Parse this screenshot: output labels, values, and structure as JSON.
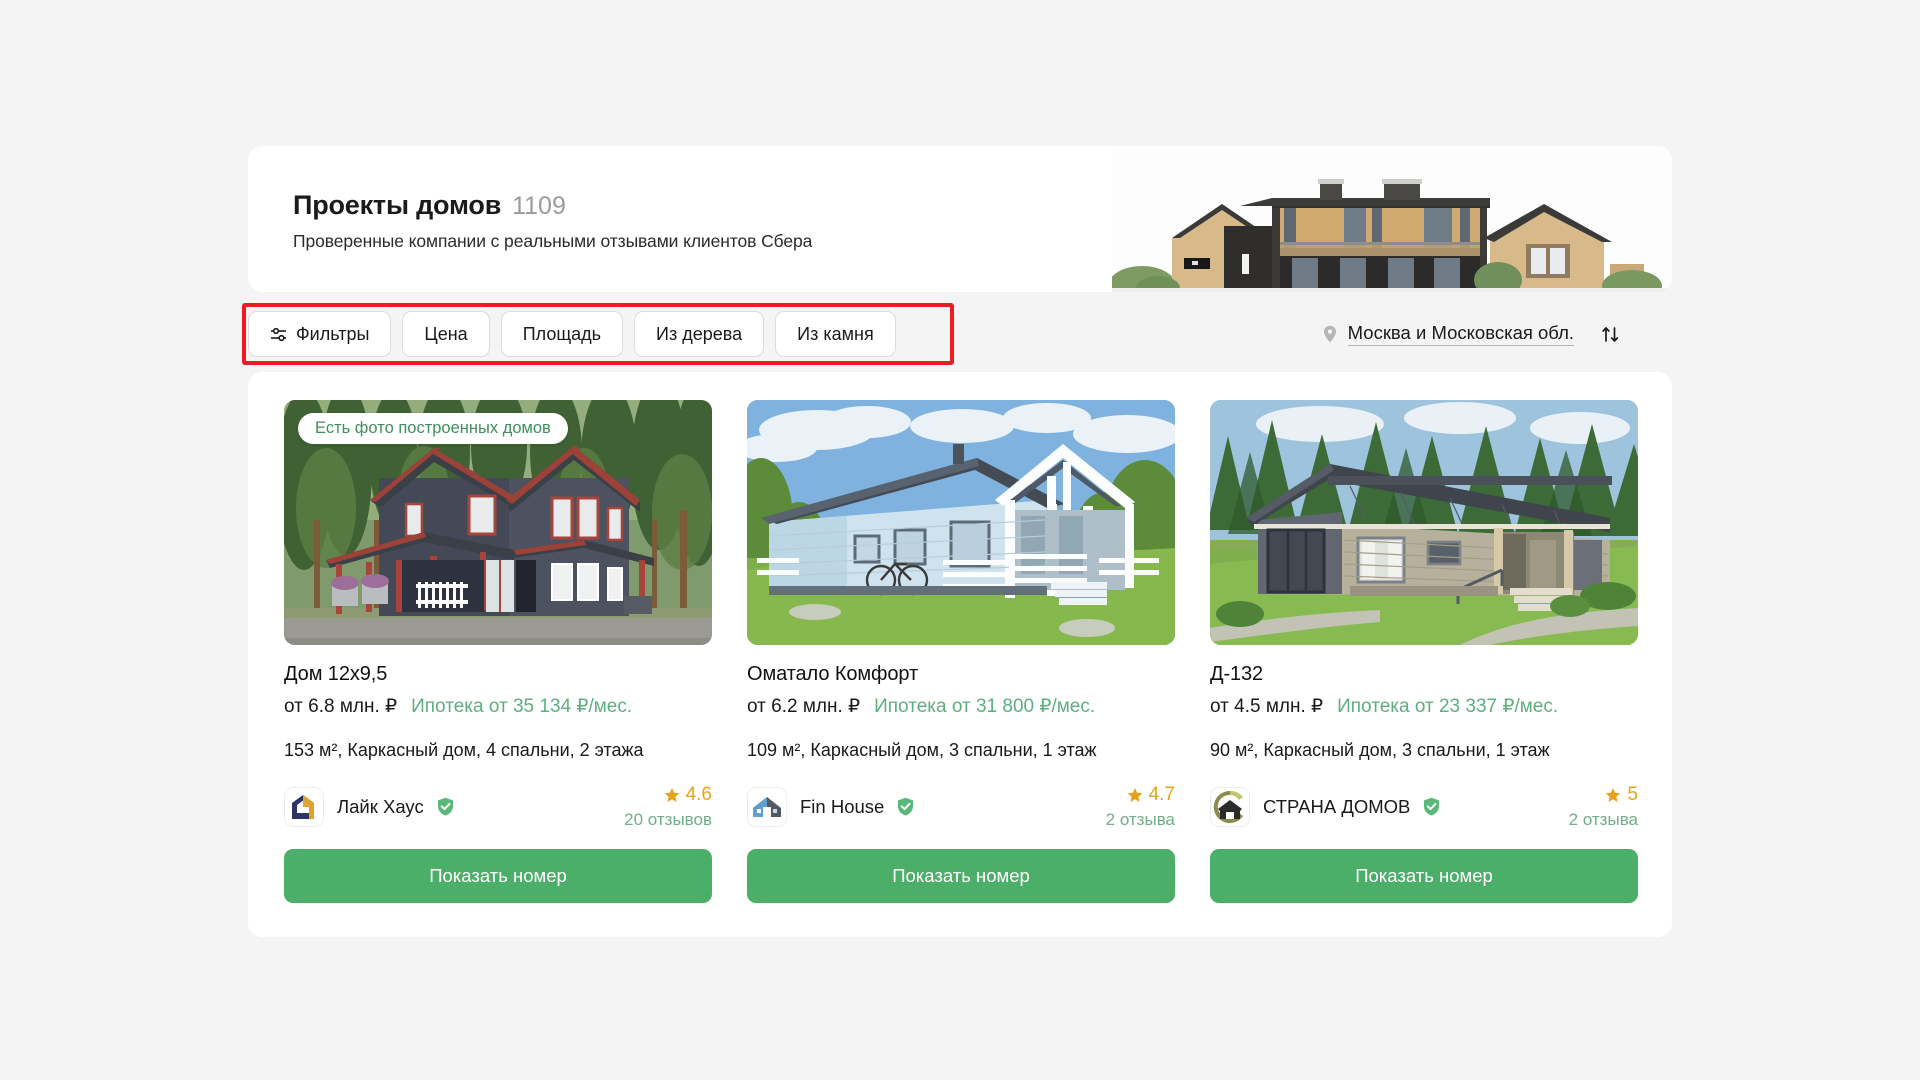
{
  "header": {
    "title": "Проекты домов",
    "count": "1109",
    "subtitle": "Проверенные компании с реальными отзывами клиентов Сбера",
    "hero_icon": "modern-house-photo"
  },
  "filters": {
    "highlight_color": "#ec1c24",
    "chips": [
      {
        "label": "Фильтры",
        "icon": "sliders-icon",
        "has_icon": true
      },
      {
        "label": "Цена",
        "icon": "",
        "has_icon": false
      },
      {
        "label": "Площадь",
        "icon": "",
        "has_icon": false
      },
      {
        "label": "Из дерева",
        "icon": "",
        "has_icon": false
      },
      {
        "label": "Из камня",
        "icon": "",
        "has_icon": false
      }
    ],
    "location": {
      "icon": "map-pin-icon",
      "label": "Москва и Московская обл."
    },
    "sort": {
      "icon": "sort-arrows-icon"
    }
  },
  "listings": [
    {
      "badge": "Есть фото построенных домов",
      "has_badge": true,
      "photo_icon": "dark-grey-two-story-house-photo",
      "title": "Дом 12х9,5",
      "price": "от 6.8 млн. ₽",
      "mortgage": "Ипотека от 35 134 ₽/мес.",
      "specs": "153 м², Каркасный дом, 4 спальни, 2 этажа",
      "company": {
        "name": "Лайк Хаус",
        "logo_icon": "like-haus-logo",
        "verified": true
      },
      "rating": "4.6",
      "reviews": "20 отзывов",
      "cta": "Показать номер"
    },
    {
      "badge": "",
      "has_badge": false,
      "photo_icon": "light-blue-one-story-house-photo",
      "title": "Оматало Комфорт",
      "price": "от 6.2 млн. ₽",
      "mortgage": "Ипотека от 31 800 ₽/мес.",
      "specs": "109 м², Каркасный дом, 3 спальни, 1 этаж",
      "company": {
        "name": "Fin House",
        "logo_icon": "fin-house-logo",
        "verified": true
      },
      "rating": "4.7",
      "reviews": "2 отзыва",
      "cta": "Показать номер"
    },
    {
      "badge": "",
      "has_badge": false,
      "photo_icon": "grey-beige-one-story-house-photo",
      "title": "Д-132",
      "price": "от 4.5 млн. ₽",
      "mortgage": "Ипотека от 23 337 ₽/мес.",
      "specs": "90 м², Каркасный дом, 3 спальни, 1 этаж",
      "company": {
        "name": "СТРАНА ДОМОВ",
        "logo_icon": "strana-domov-logo",
        "verified": true
      },
      "rating": "5",
      "reviews": "2 отзыва",
      "cta": "Показать номер"
    }
  ],
  "colors": {
    "page_background": "#f4f4f4",
    "card_background": "#ffffff",
    "accent_green": "#4caf69",
    "mortgage_green": "#5fae80",
    "reviews_green": "#6fae86",
    "star_orange": "#e8a218",
    "highlight_red": "#ec1c24"
  }
}
